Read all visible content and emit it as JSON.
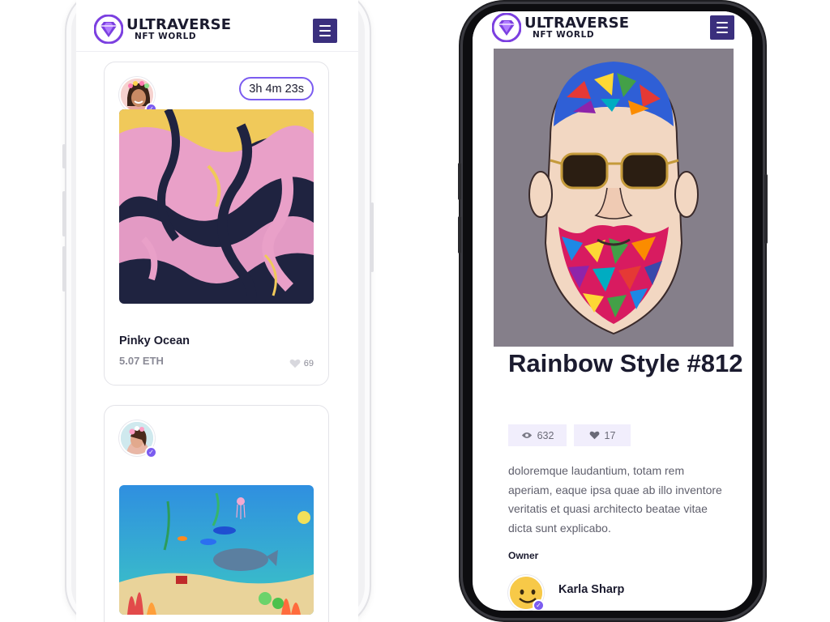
{
  "brand": {
    "title": "ULTRAVERSE",
    "subtitle": "NFT WORLD",
    "accent": "#7b5cf0",
    "menu_color": "#3a2f7d"
  },
  "left_screen": {
    "cards": [
      {
        "timer": "3h 4m 23s",
        "name": "Pinky Ocean",
        "price": "5.07 ETH",
        "likes": "69",
        "avatar": "woman-with-flower-crown",
        "art": "pink-marble-art"
      },
      {
        "avatar": "woman-with-flowers",
        "art": "underwater-ocean-scene"
      }
    ]
  },
  "right_screen": {
    "art": "rainbow-bearded-man-painting",
    "title": "Rainbow Style #812",
    "views": "632",
    "likes": "17",
    "description": "doloremque laudantium, totam rem aperiam, eaque ipsa quae ab illo inventore veritatis et quasi architecto beatae vitae dicta sunt explicabo.",
    "owner_label": "Owner",
    "owner_name": "Karla Sharp"
  }
}
